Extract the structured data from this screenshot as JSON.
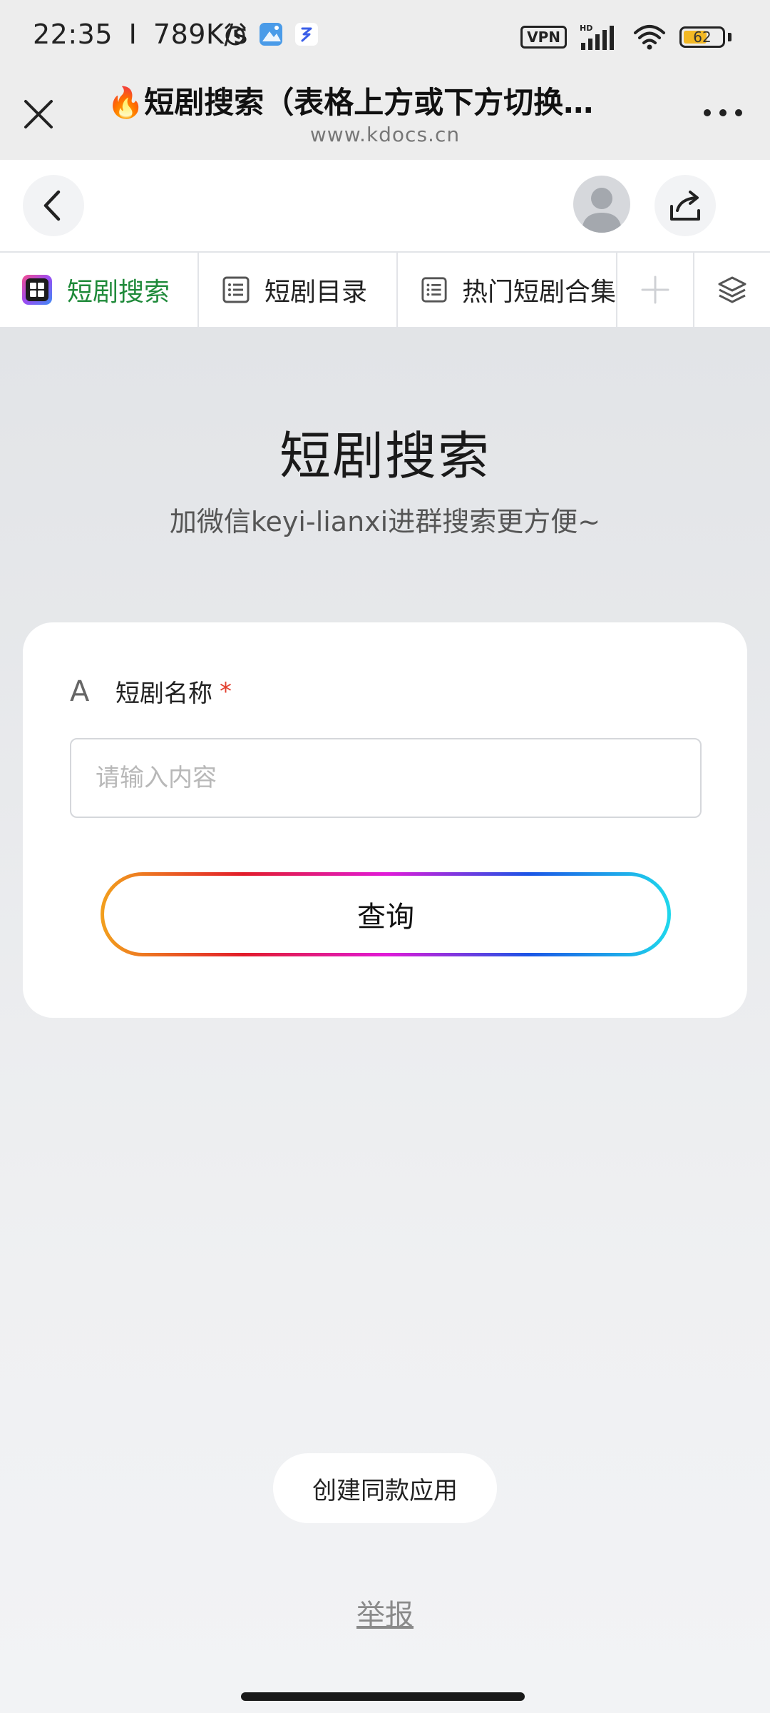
{
  "status_bar": {
    "time": "22:35",
    "separator": "I",
    "net_speed": "789K/s",
    "vpn_label": "VPN",
    "hd_label": "HD",
    "battery_level": "62",
    "battery_fraction": 0.62
  },
  "browser": {
    "title": "🔥短剧搜索（表格上方或下方切换…",
    "url": "www.kdocs.cn"
  },
  "tabs": [
    {
      "label": "短剧搜索",
      "icon": "app-grid-icon",
      "active": true
    },
    {
      "label": "短剧目录",
      "icon": "list-doc-icon",
      "active": false
    },
    {
      "label": "热门短剧合集",
      "icon": "list-doc-icon",
      "active": false
    }
  ],
  "page": {
    "title": "短剧搜索",
    "subtitle": "加微信keyi-lianxi进群搜索更方便~"
  },
  "form": {
    "field_type_glyph": "A",
    "field_label": "短剧名称",
    "required_mark": "*",
    "input_value": "",
    "input_placeholder": "请输入内容",
    "submit_label": "查询"
  },
  "footer": {
    "create_same_label": "创建同款应用",
    "report_label": "举报"
  },
  "colors": {
    "active_tab_text": "#1f8a3a",
    "required": "#e2402f",
    "battery_fill": "#f2b824"
  }
}
